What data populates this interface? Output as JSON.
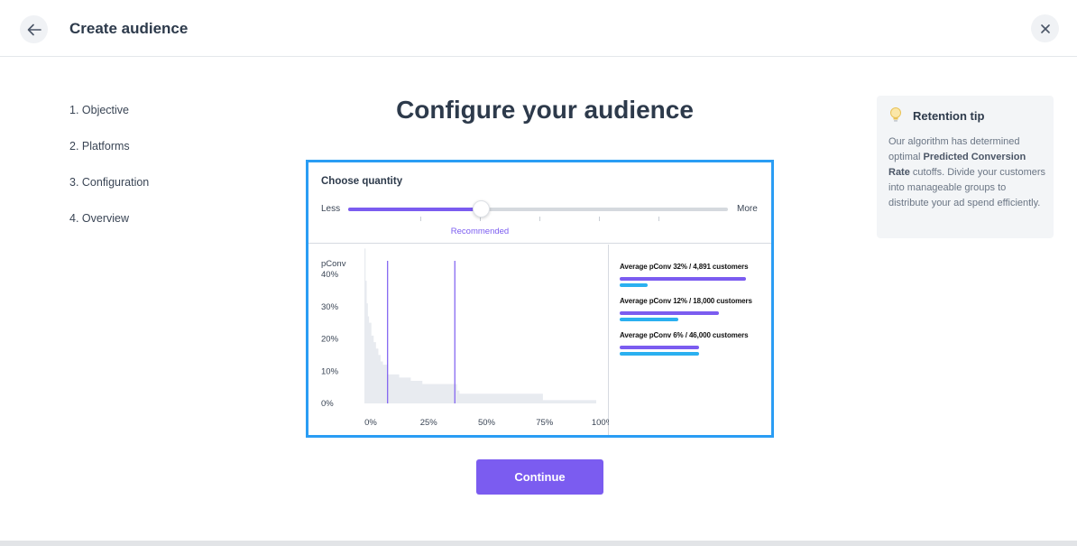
{
  "header": {
    "title": "Create audience"
  },
  "steps": [
    "1. Objective",
    "2. Platforms",
    "3. Configuration",
    "4. Overview"
  ],
  "active_step_index": 2,
  "main": {
    "title": "Configure your audience",
    "continue_label": "Continue"
  },
  "quantity": {
    "title": "Choose quantity",
    "less_label": "Less",
    "more_label": "More",
    "recommended_label": "Recommended",
    "slider_value": 0.35
  },
  "chart_data": {
    "type": "area",
    "ylabel": "pConv",
    "y_ticks": [
      "40%",
      "30%",
      "20%",
      "10%",
      "0%"
    ],
    "x_ticks": [
      "0%",
      "25%",
      "50%",
      "75%",
      "100%"
    ],
    "ylim": [
      0,
      48
    ],
    "xlim": [
      0,
      100
    ],
    "x": [
      0,
      0.5,
      1,
      1.5,
      2,
      3,
      4,
      5,
      6,
      7,
      8,
      10,
      15,
      20,
      25,
      30,
      35,
      39,
      40,
      41,
      45,
      50,
      60,
      70,
      77,
      80,
      90,
      100
    ],
    "y": [
      48,
      38,
      31,
      27,
      25,
      21,
      19,
      17,
      15,
      13,
      12,
      9,
      8,
      7,
      6,
      6,
      6,
      6,
      4,
      3,
      3,
      3,
      3,
      3,
      1,
      1,
      1,
      1
    ],
    "cutoffs": [
      10,
      39
    ],
    "colors": {
      "fill": "#e8ebf0",
      "cutoff": "#7b5cf0",
      "axis_text": "#3a4555"
    }
  },
  "segments": [
    {
      "label": "Average pConv 32% / 4,891 customers",
      "purple_fraction": 0.9,
      "blue_fraction": 0.2
    },
    {
      "label": "Average pConv 12% / 18,000 customers",
      "purple_fraction": 0.71,
      "blue_fraction": 0.42
    },
    {
      "label": "Average pConv 6% / 46,000 customers",
      "purple_fraction": 0.57,
      "blue_fraction": 0.57
    }
  ],
  "tip": {
    "title": "Retention tip",
    "text_before": "Our algorithm has determined optimal ",
    "text_bold": "Predicted Conversion Rate",
    "text_after": " cutoffs. Divide your customers into manageable groups to distribute your ad spend efficiently."
  },
  "colors": {
    "accent": "#7b5cf0",
    "highlight_border": "#2a9df4",
    "blue_bar": "#2ab0f0"
  }
}
